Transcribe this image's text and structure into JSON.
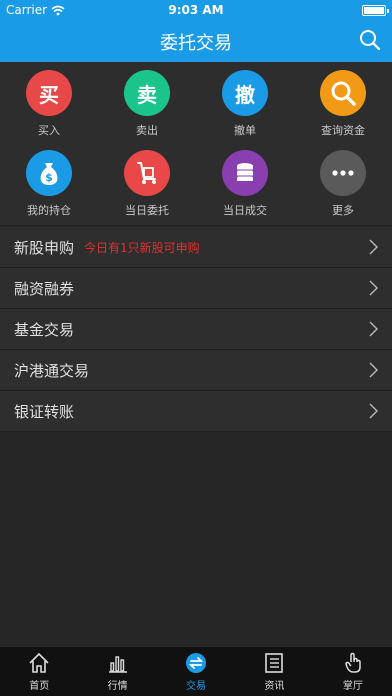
{
  "status_bar": {
    "carrier": "Carrier",
    "time": "9:03 AM"
  },
  "header": {
    "title": "委托交易"
  },
  "grid": [
    {
      "label": "买入",
      "glyph": "买",
      "color": "#e84848",
      "icon": "buy-icon"
    },
    {
      "label": "卖出",
      "glyph": "卖",
      "color": "#1bc48a",
      "icon": "sell-icon"
    },
    {
      "label": "撤单",
      "glyph": "撤",
      "color": "#1b9be6",
      "icon": "cancel-order-icon"
    },
    {
      "label": "查询资金",
      "glyph": "",
      "color": "#f29a16",
      "icon": "magnifier-icon"
    },
    {
      "label": "我的持仓",
      "glyph": "",
      "color": "#1b9be6",
      "icon": "money-bag-icon"
    },
    {
      "label": "当日委托",
      "glyph": "",
      "color": "#e84848",
      "icon": "hand-truck-icon"
    },
    {
      "label": "当日成交",
      "glyph": "",
      "color": "#8a3fb0",
      "icon": "coin-stack-icon"
    },
    {
      "label": "更多",
      "glyph": "",
      "color": "#5a5a5a",
      "icon": "more-dots-icon"
    }
  ],
  "menu": [
    {
      "label": "新股申购",
      "promo": "今日有1只新股可申购"
    },
    {
      "label": "融资融券",
      "promo": ""
    },
    {
      "label": "基金交易",
      "promo": ""
    },
    {
      "label": "沪港通交易",
      "promo": ""
    },
    {
      "label": "银证转账",
      "promo": ""
    }
  ],
  "tabs": [
    {
      "label": "首页",
      "icon": "home-icon"
    },
    {
      "label": "行情",
      "icon": "bar-chart-icon"
    },
    {
      "label": "交易",
      "icon": "exchange-icon"
    },
    {
      "label": "资讯",
      "icon": "news-icon"
    },
    {
      "label": "掌厅",
      "icon": "hand-tap-icon"
    }
  ],
  "active_tab_index": 2,
  "colors": {
    "brand": "#1a9be8",
    "promo": "#e0302e"
  }
}
